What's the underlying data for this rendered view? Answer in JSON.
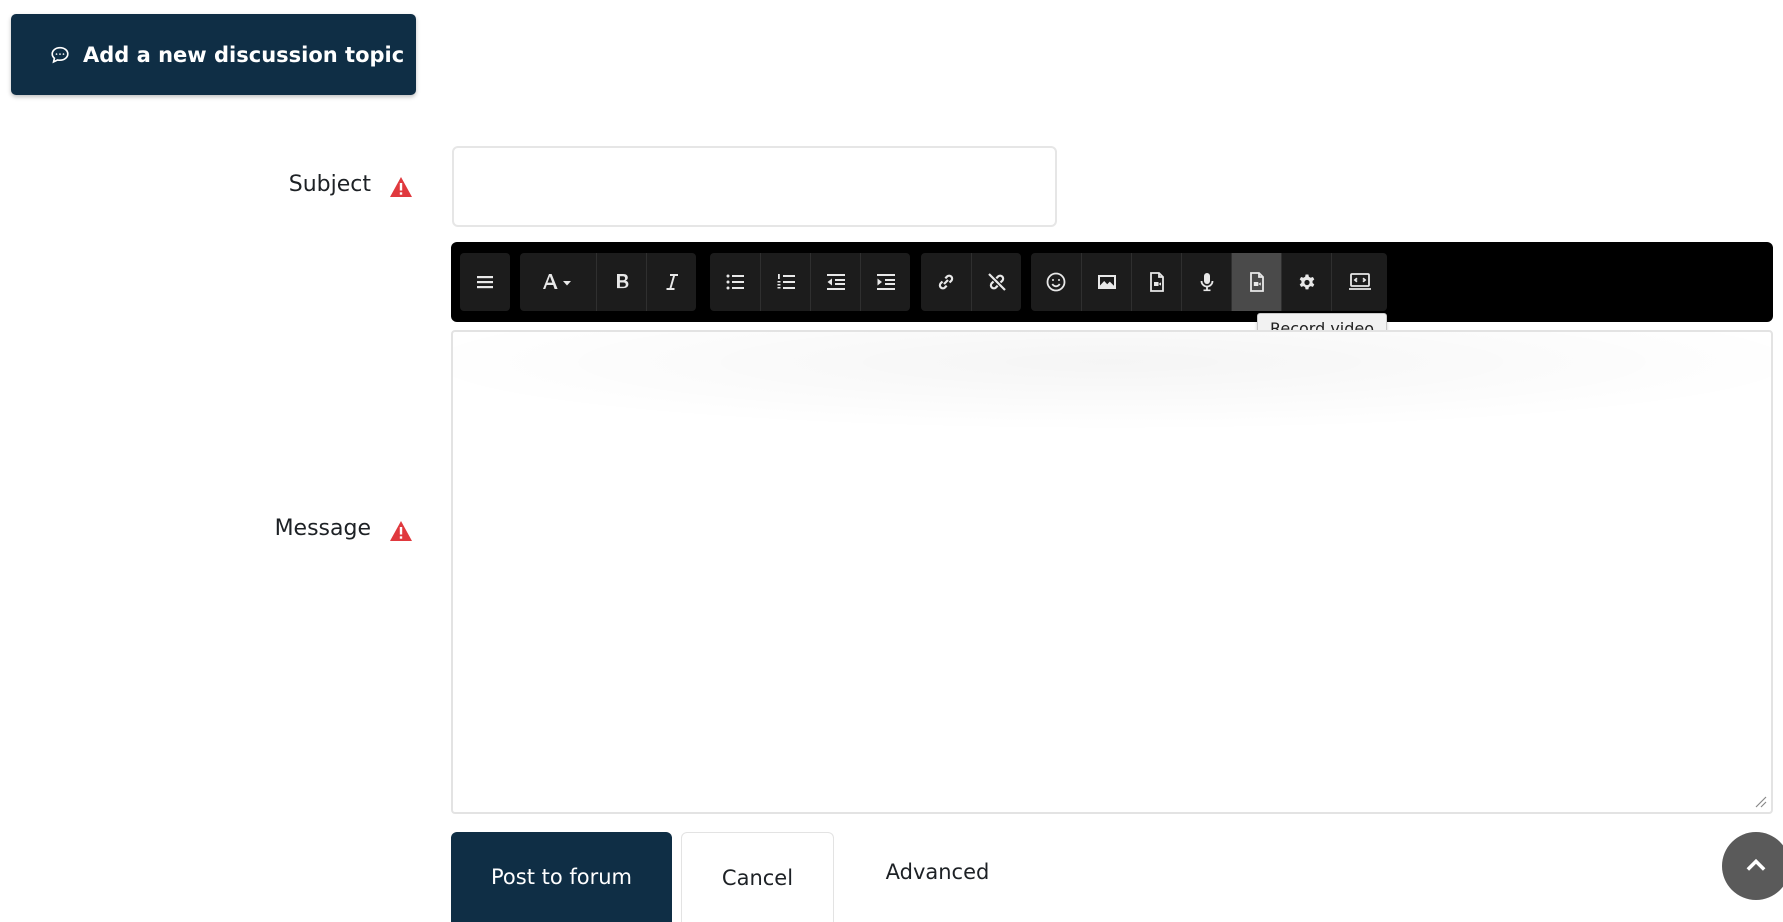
{
  "header": {
    "add_topic_label": "Add a new discussion topic",
    "add_topic_icon": "comment-icon"
  },
  "form": {
    "subject_label": "Subject",
    "subject_value": "",
    "message_label": "Message",
    "required_icon": "warning-triangle-icon",
    "required_color": "#e0393e"
  },
  "toolbar": {
    "buttons": [
      {
        "name": "toolbar-toggle",
        "icon": "hamburger-icon"
      },
      {
        "name": "font-style",
        "icon": "font-A-dropdown-icon"
      },
      {
        "name": "bold",
        "icon": "bold-icon"
      },
      {
        "name": "italic",
        "icon": "italic-icon"
      },
      {
        "name": "unordered-list",
        "icon": "bullet-list-icon"
      },
      {
        "name": "ordered-list",
        "icon": "numbered-list-icon"
      },
      {
        "name": "outdent",
        "icon": "outdent-icon"
      },
      {
        "name": "indent",
        "icon": "indent-icon"
      },
      {
        "name": "link",
        "icon": "link-icon"
      },
      {
        "name": "unlink",
        "icon": "unlink-icon"
      },
      {
        "name": "emoji",
        "icon": "smiley-icon"
      },
      {
        "name": "image",
        "icon": "image-icon"
      },
      {
        "name": "media",
        "icon": "file-media-icon"
      },
      {
        "name": "record-audio",
        "icon": "microphone-icon"
      },
      {
        "name": "record-video",
        "icon": "record-video-icon"
      },
      {
        "name": "manage-files",
        "icon": "gear-icon"
      },
      {
        "name": "html-mode",
        "icon": "screen-code-icon"
      }
    ],
    "active_button": "record-video",
    "tooltip": "Record video",
    "background": "#000000"
  },
  "actions": {
    "post_label": "Post to forum",
    "cancel_label": "Cancel",
    "advanced_label": "Advanced"
  },
  "colors": {
    "primary": "#0f2e45"
  }
}
